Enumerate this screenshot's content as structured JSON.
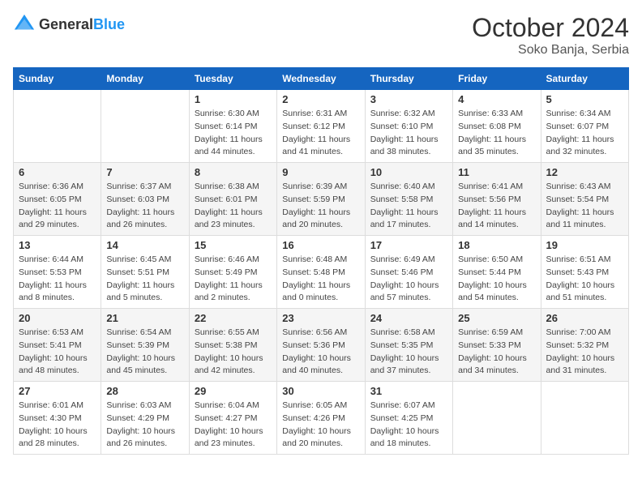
{
  "header": {
    "logo_general": "General",
    "logo_blue": "Blue",
    "month": "October 2024",
    "location": "Soko Banja, Serbia"
  },
  "weekdays": [
    "Sunday",
    "Monday",
    "Tuesday",
    "Wednesday",
    "Thursday",
    "Friday",
    "Saturday"
  ],
  "weeks": [
    [
      {
        "day": "",
        "sunrise": "",
        "sunset": "",
        "daylight": ""
      },
      {
        "day": "",
        "sunrise": "",
        "sunset": "",
        "daylight": ""
      },
      {
        "day": "1",
        "sunrise": "Sunrise: 6:30 AM",
        "sunset": "Sunset: 6:14 PM",
        "daylight": "Daylight: 11 hours and 44 minutes."
      },
      {
        "day": "2",
        "sunrise": "Sunrise: 6:31 AM",
        "sunset": "Sunset: 6:12 PM",
        "daylight": "Daylight: 11 hours and 41 minutes."
      },
      {
        "day": "3",
        "sunrise": "Sunrise: 6:32 AM",
        "sunset": "Sunset: 6:10 PM",
        "daylight": "Daylight: 11 hours and 38 minutes."
      },
      {
        "day": "4",
        "sunrise": "Sunrise: 6:33 AM",
        "sunset": "Sunset: 6:08 PM",
        "daylight": "Daylight: 11 hours and 35 minutes."
      },
      {
        "day": "5",
        "sunrise": "Sunrise: 6:34 AM",
        "sunset": "Sunset: 6:07 PM",
        "daylight": "Daylight: 11 hours and 32 minutes."
      }
    ],
    [
      {
        "day": "6",
        "sunrise": "Sunrise: 6:36 AM",
        "sunset": "Sunset: 6:05 PM",
        "daylight": "Daylight: 11 hours and 29 minutes."
      },
      {
        "day": "7",
        "sunrise": "Sunrise: 6:37 AM",
        "sunset": "Sunset: 6:03 PM",
        "daylight": "Daylight: 11 hours and 26 minutes."
      },
      {
        "day": "8",
        "sunrise": "Sunrise: 6:38 AM",
        "sunset": "Sunset: 6:01 PM",
        "daylight": "Daylight: 11 hours and 23 minutes."
      },
      {
        "day": "9",
        "sunrise": "Sunrise: 6:39 AM",
        "sunset": "Sunset: 5:59 PM",
        "daylight": "Daylight: 11 hours and 20 minutes."
      },
      {
        "day": "10",
        "sunrise": "Sunrise: 6:40 AM",
        "sunset": "Sunset: 5:58 PM",
        "daylight": "Daylight: 11 hours and 17 minutes."
      },
      {
        "day": "11",
        "sunrise": "Sunrise: 6:41 AM",
        "sunset": "Sunset: 5:56 PM",
        "daylight": "Daylight: 11 hours and 14 minutes."
      },
      {
        "day": "12",
        "sunrise": "Sunrise: 6:43 AM",
        "sunset": "Sunset: 5:54 PM",
        "daylight": "Daylight: 11 hours and 11 minutes."
      }
    ],
    [
      {
        "day": "13",
        "sunrise": "Sunrise: 6:44 AM",
        "sunset": "Sunset: 5:53 PM",
        "daylight": "Daylight: 11 hours and 8 minutes."
      },
      {
        "day": "14",
        "sunrise": "Sunrise: 6:45 AM",
        "sunset": "Sunset: 5:51 PM",
        "daylight": "Daylight: 11 hours and 5 minutes."
      },
      {
        "day": "15",
        "sunrise": "Sunrise: 6:46 AM",
        "sunset": "Sunset: 5:49 PM",
        "daylight": "Daylight: 11 hours and 2 minutes."
      },
      {
        "day": "16",
        "sunrise": "Sunrise: 6:48 AM",
        "sunset": "Sunset: 5:48 PM",
        "daylight": "Daylight: 11 hours and 0 minutes."
      },
      {
        "day": "17",
        "sunrise": "Sunrise: 6:49 AM",
        "sunset": "Sunset: 5:46 PM",
        "daylight": "Daylight: 10 hours and 57 minutes."
      },
      {
        "day": "18",
        "sunrise": "Sunrise: 6:50 AM",
        "sunset": "Sunset: 5:44 PM",
        "daylight": "Daylight: 10 hours and 54 minutes."
      },
      {
        "day": "19",
        "sunrise": "Sunrise: 6:51 AM",
        "sunset": "Sunset: 5:43 PM",
        "daylight": "Daylight: 10 hours and 51 minutes."
      }
    ],
    [
      {
        "day": "20",
        "sunrise": "Sunrise: 6:53 AM",
        "sunset": "Sunset: 5:41 PM",
        "daylight": "Daylight: 10 hours and 48 minutes."
      },
      {
        "day": "21",
        "sunrise": "Sunrise: 6:54 AM",
        "sunset": "Sunset: 5:39 PM",
        "daylight": "Daylight: 10 hours and 45 minutes."
      },
      {
        "day": "22",
        "sunrise": "Sunrise: 6:55 AM",
        "sunset": "Sunset: 5:38 PM",
        "daylight": "Daylight: 10 hours and 42 minutes."
      },
      {
        "day": "23",
        "sunrise": "Sunrise: 6:56 AM",
        "sunset": "Sunset: 5:36 PM",
        "daylight": "Daylight: 10 hours and 40 minutes."
      },
      {
        "day": "24",
        "sunrise": "Sunrise: 6:58 AM",
        "sunset": "Sunset: 5:35 PM",
        "daylight": "Daylight: 10 hours and 37 minutes."
      },
      {
        "day": "25",
        "sunrise": "Sunrise: 6:59 AM",
        "sunset": "Sunset: 5:33 PM",
        "daylight": "Daylight: 10 hours and 34 minutes."
      },
      {
        "day": "26",
        "sunrise": "Sunrise: 7:00 AM",
        "sunset": "Sunset: 5:32 PM",
        "daylight": "Daylight: 10 hours and 31 minutes."
      }
    ],
    [
      {
        "day": "27",
        "sunrise": "Sunrise: 6:01 AM",
        "sunset": "Sunset: 4:30 PM",
        "daylight": "Daylight: 10 hours and 28 minutes."
      },
      {
        "day": "28",
        "sunrise": "Sunrise: 6:03 AM",
        "sunset": "Sunset: 4:29 PM",
        "daylight": "Daylight: 10 hours and 26 minutes."
      },
      {
        "day": "29",
        "sunrise": "Sunrise: 6:04 AM",
        "sunset": "Sunset: 4:27 PM",
        "daylight": "Daylight: 10 hours and 23 minutes."
      },
      {
        "day": "30",
        "sunrise": "Sunrise: 6:05 AM",
        "sunset": "Sunset: 4:26 PM",
        "daylight": "Daylight: 10 hours and 20 minutes."
      },
      {
        "day": "31",
        "sunrise": "Sunrise: 6:07 AM",
        "sunset": "Sunset: 4:25 PM",
        "daylight": "Daylight: 10 hours and 18 minutes."
      },
      {
        "day": "",
        "sunrise": "",
        "sunset": "",
        "daylight": ""
      },
      {
        "day": "",
        "sunrise": "",
        "sunset": "",
        "daylight": ""
      }
    ]
  ]
}
